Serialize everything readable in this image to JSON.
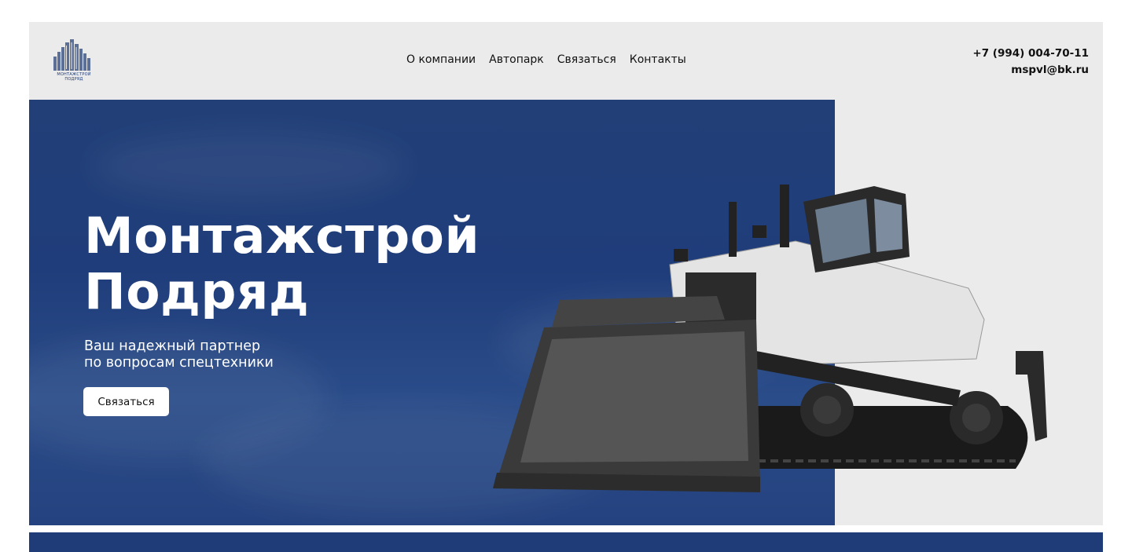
{
  "brand": {
    "logo_line1": "МОНТАЖСТРОЙ",
    "logo_line2": "ПОДРЯД",
    "color": "#1f3c78"
  },
  "nav": {
    "items": [
      {
        "label": "О компании"
      },
      {
        "label": "Автопарк"
      },
      {
        "label": "Связаться"
      },
      {
        "label": "Контакты"
      }
    ]
  },
  "contact": {
    "phone": "+7 (994) 004-70-11",
    "email": "mspvl@bk.ru"
  },
  "hero": {
    "title_line1": "Монтажстрой",
    "title_line2": "Подряд",
    "subtitle_line1": "Ваш надежный партнер",
    "subtitle_line2": "по вопросам спецтехники",
    "cta_label": "Связаться",
    "image": "bulldozer"
  },
  "colors": {
    "header_bg": "#ebebeb",
    "hero_blue": "#1f3d7a",
    "band": "#1f3c78"
  }
}
